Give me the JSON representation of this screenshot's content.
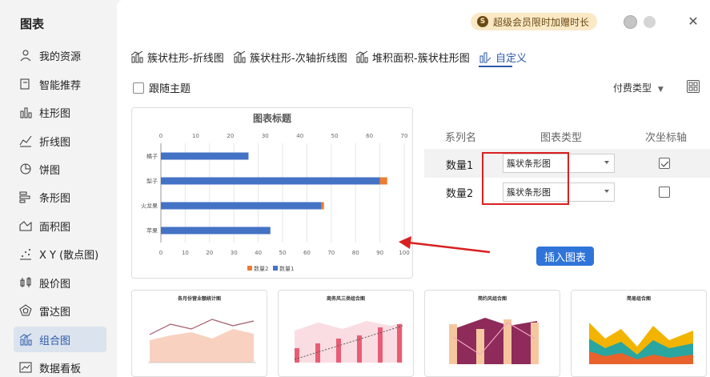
{
  "sidebar": {
    "title": "图表",
    "items": [
      {
        "label": "我的资源",
        "icon": "user-icon"
      },
      {
        "label": "智能推荐",
        "icon": "recommend-icon"
      },
      {
        "label": "柱形图",
        "icon": "column-chart-icon"
      },
      {
        "label": "折线图",
        "icon": "line-chart-icon"
      },
      {
        "label": "饼图",
        "icon": "pie-chart-icon"
      },
      {
        "label": "条形图",
        "icon": "bar-chart-icon"
      },
      {
        "label": "面积图",
        "icon": "area-chart-icon"
      },
      {
        "label": "X Y (散点图)",
        "icon": "scatter-chart-icon"
      },
      {
        "label": "股价图",
        "icon": "stock-chart-icon"
      },
      {
        "label": "雷达图",
        "icon": "radar-chart-icon"
      },
      {
        "label": "组合图",
        "icon": "combo-chart-icon",
        "active": true
      },
      {
        "label": "数据看板",
        "icon": "dashboard-icon"
      }
    ]
  },
  "header": {
    "promo": "超级会员限时加赠时长",
    "promo_badge": "S"
  },
  "tabs": [
    {
      "label": "簇状柱形-折线图"
    },
    {
      "label": "簇状柱形-次轴折线图"
    },
    {
      "label": "堆积面积-簇状柱形图"
    },
    {
      "label": "自定义",
      "active": true
    }
  ],
  "follow_theme": "跟随主题",
  "paid_type": "付费类型",
  "table": {
    "headers": [
      "系列名",
      "图表类型",
      "次坐标轴"
    ],
    "rows": [
      {
        "name": "数量1",
        "type": "簇状条形图",
        "secondary": true
      },
      {
        "name": "数量2",
        "type": "簇状条形图",
        "secondary": false
      }
    ]
  },
  "insert_button": "插入图表",
  "chart_data": {
    "type": "bar",
    "title": "图表标题",
    "categories": [
      "苹果",
      "火龙果",
      "梨子",
      "橘子"
    ],
    "series": [
      {
        "name": "数量1",
        "values": [
          45,
          66,
          90,
          36
        ]
      },
      {
        "name": "数量2",
        "values": [
          0,
          1,
          3,
          0
        ]
      }
    ],
    "xlim": [
      0,
      100
    ],
    "x_ticks_bottom": [
      0,
      10,
      20,
      30,
      40,
      50,
      60,
      70,
      80,
      90,
      100
    ],
    "x_ticks_top": [
      0,
      10,
      20,
      30,
      40,
      50,
      60,
      70
    ],
    "legend": [
      "数量2",
      "数量1"
    ],
    "colors": {
      "series1": "#4472c4",
      "series2": "#ed7d31"
    }
  },
  "thumbnails": [
    {
      "title": "各月份营业额统计图"
    },
    {
      "title": "商务风三类组合图"
    },
    {
      "title": "简约风组合图"
    },
    {
      "title": "简易组合图"
    }
  ]
}
